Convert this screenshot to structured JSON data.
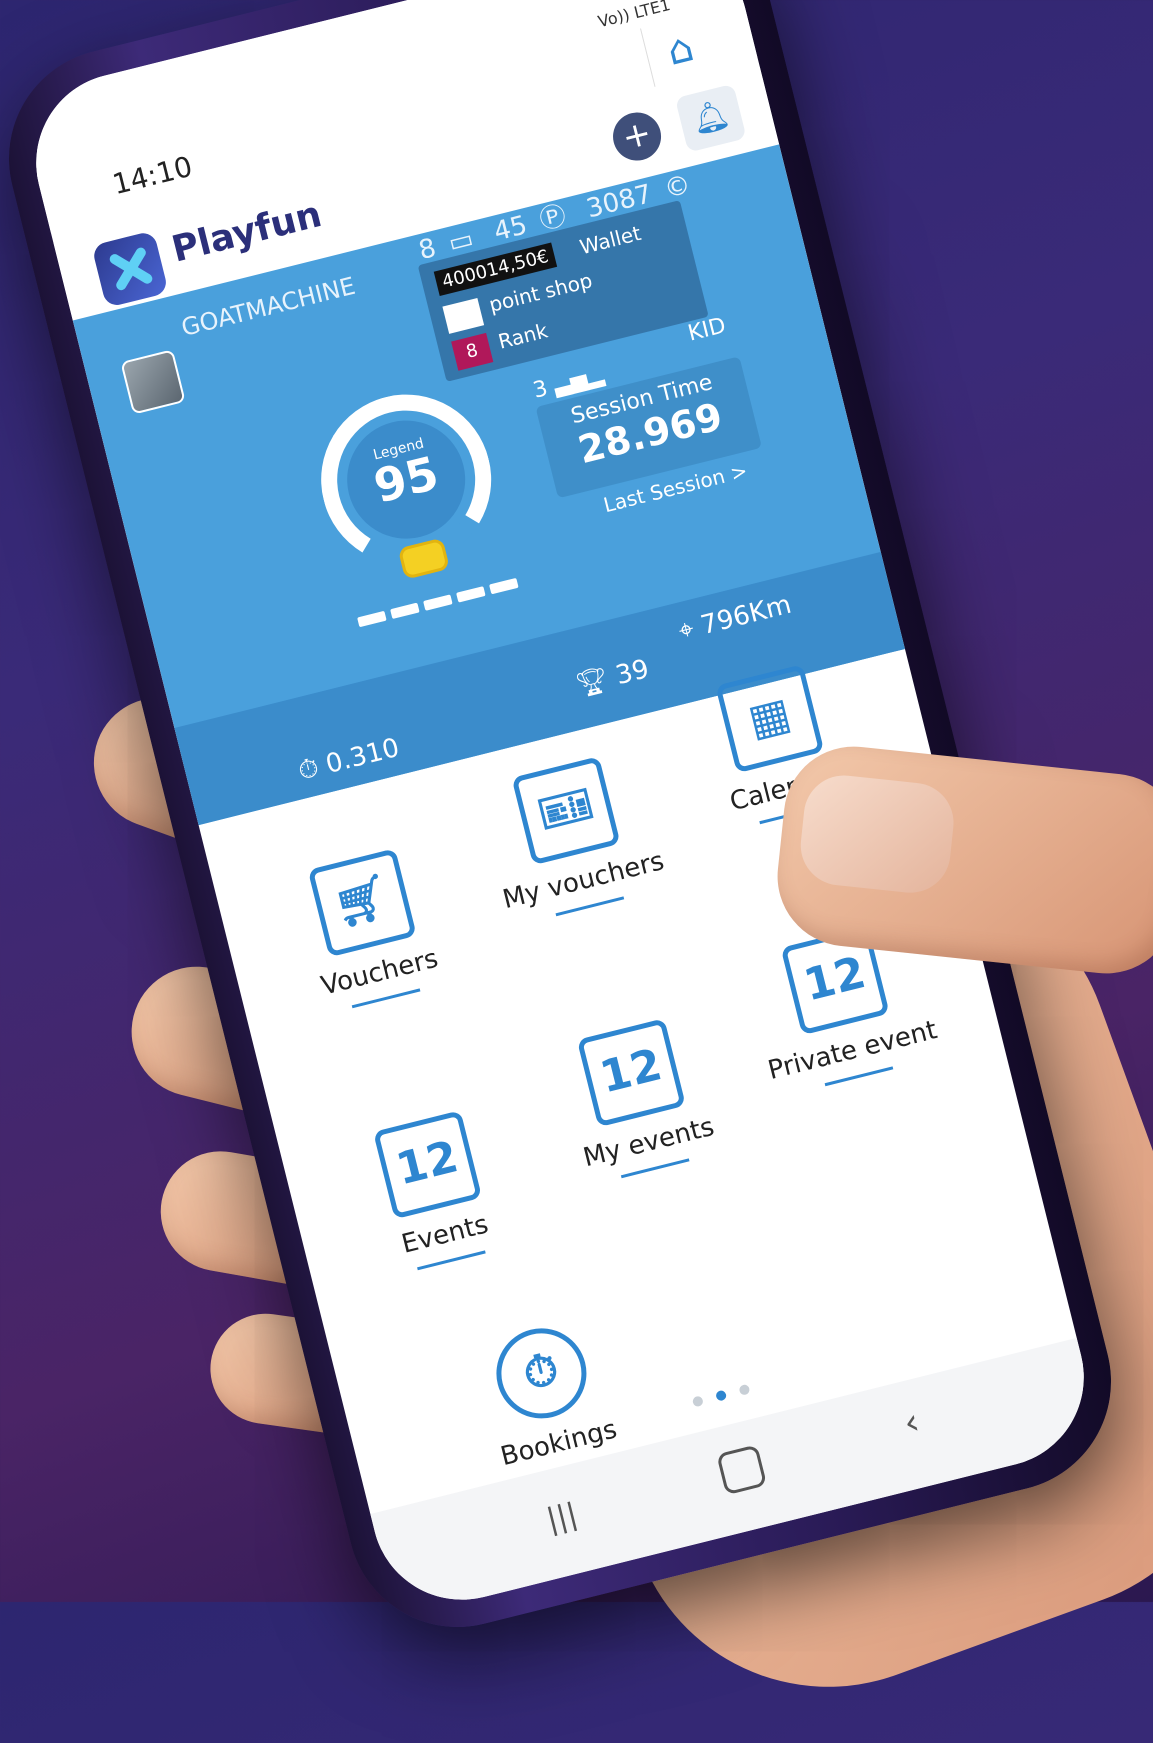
{
  "status_bar": {
    "time": "14:10",
    "signal": "Vo)) LTE1"
  },
  "app": {
    "name": "Playfun"
  },
  "header": {
    "tickets": "8",
    "points": "45",
    "credits": "3087",
    "plus_label": "+",
    "home_icon": "home-icon",
    "bell_icon": "bell-icon"
  },
  "profile": {
    "username": "GOATMACHINE",
    "wallet_amount": "400014,50€",
    "wallet_label": "Wallet",
    "point_shop_label": "point shop",
    "rank_value": "8",
    "rank_label": "Rank",
    "category": "KID",
    "podium_count": "3",
    "session_time_label": "Session Time",
    "session_time_value": "28.969",
    "last_session_label": "Last Session >",
    "level_label": "Legend",
    "level_value": "95",
    "best_lap": "0.310",
    "trophies": "39",
    "distance": "796Km"
  },
  "menu": {
    "items": [
      {
        "label": "Vouchers",
        "icon": "cart-icon"
      },
      {
        "label": "My vouchers",
        "icon": "tickets-icon"
      },
      {
        "label": "Calendar",
        "icon": "calendar-icon"
      },
      {
        "label": "Events",
        "icon": "calendar-cart-icon"
      },
      {
        "label": "My events",
        "icon": "calendar-helmet-icon"
      },
      {
        "label": "Private event",
        "icon": "calendar-private-icon"
      },
      {
        "label": "Bookings",
        "icon": "stopwatch-cart-icon"
      }
    ]
  },
  "pagination": {
    "total": 3,
    "active": 2
  },
  "colors": {
    "primary": "#4aa0dc",
    "accent": "#2e86d0",
    "brand": "#2b2f7a"
  }
}
